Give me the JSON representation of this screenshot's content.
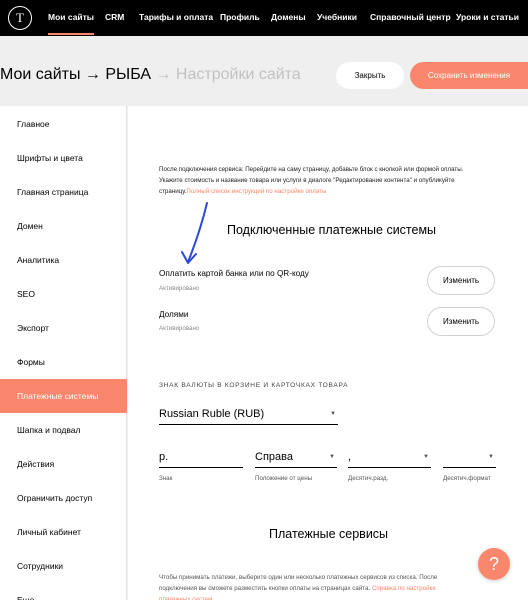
{
  "topnav": {
    "logo": "T",
    "items": [
      "Мои сайты",
      "CRM",
      "Тарифы и оплата",
      "Профиль",
      "Домены",
      "Учебники",
      "Справочный центр",
      "Уроки и статьи"
    ]
  },
  "header": {
    "breadcrumb": [
      "Мои сайты",
      "→",
      "РЫБА",
      "→",
      "Настройки сайта"
    ],
    "close_label": "Закрыть",
    "save_label": "Сохранить изменения"
  },
  "sidebar": {
    "items": [
      "Главное",
      "Шрифты и цвета",
      "Главная страница",
      "Домен",
      "Аналитика",
      "SEO",
      "Экспорт",
      "Формы",
      "Платежные системы",
      "Шапка и подвал",
      "Действия",
      "Ограничить доступ",
      "Личный кабинет",
      "Сотрудники",
      "Еще"
    ],
    "active_index": 8
  },
  "main": {
    "intro_text": "После подключения сервиса: Перейдите на саму страницу, добавьте блок с кнопкой или формой оплаты. Укажите стоимость и название товара или услуги в диалоге \"Редактирование контента\" и опубликуйте страницу.",
    "intro_link": "Полный список инструкций по настройке оплаты",
    "connected_title": "Подключенные платежные системы",
    "providers": [
      {
        "name": "Оплатить картой банка или по QR-коду",
        "status": "Активировано",
        "button": "Изменить"
      },
      {
        "name": "Долями",
        "status": "Активировано",
        "button": "Изменить"
      }
    ],
    "currency_heading": "ЗНАК ВАЛЮТЫ В КОРЗИНЕ И КАРТОЧКАХ ТОВАРА",
    "currency_value": "Russian Ruble (RUB)",
    "fields": [
      {
        "value": "р.",
        "label": "Знак"
      },
      {
        "value": "Справа",
        "label": "Положение от цены"
      },
      {
        "value": ",",
        "label": "Десятич.разд."
      },
      {
        "value": "",
        "label": "Десятич.формат"
      }
    ],
    "payment_services_title": "Платежные сервисы",
    "payment_desc": "Чтобы принимать платежи, выберите один или несколько платежных сервисов из списка. После подключения вы сможете разместить кнопки оплаты на страницах сайта.",
    "payment_link": "Справка по настройке платежных систем"
  },
  "help_label": "?",
  "colors": {
    "accent": "#fa876b",
    "nav_bg": "#000000",
    "annotation_arrow": "#2b4ad8"
  }
}
